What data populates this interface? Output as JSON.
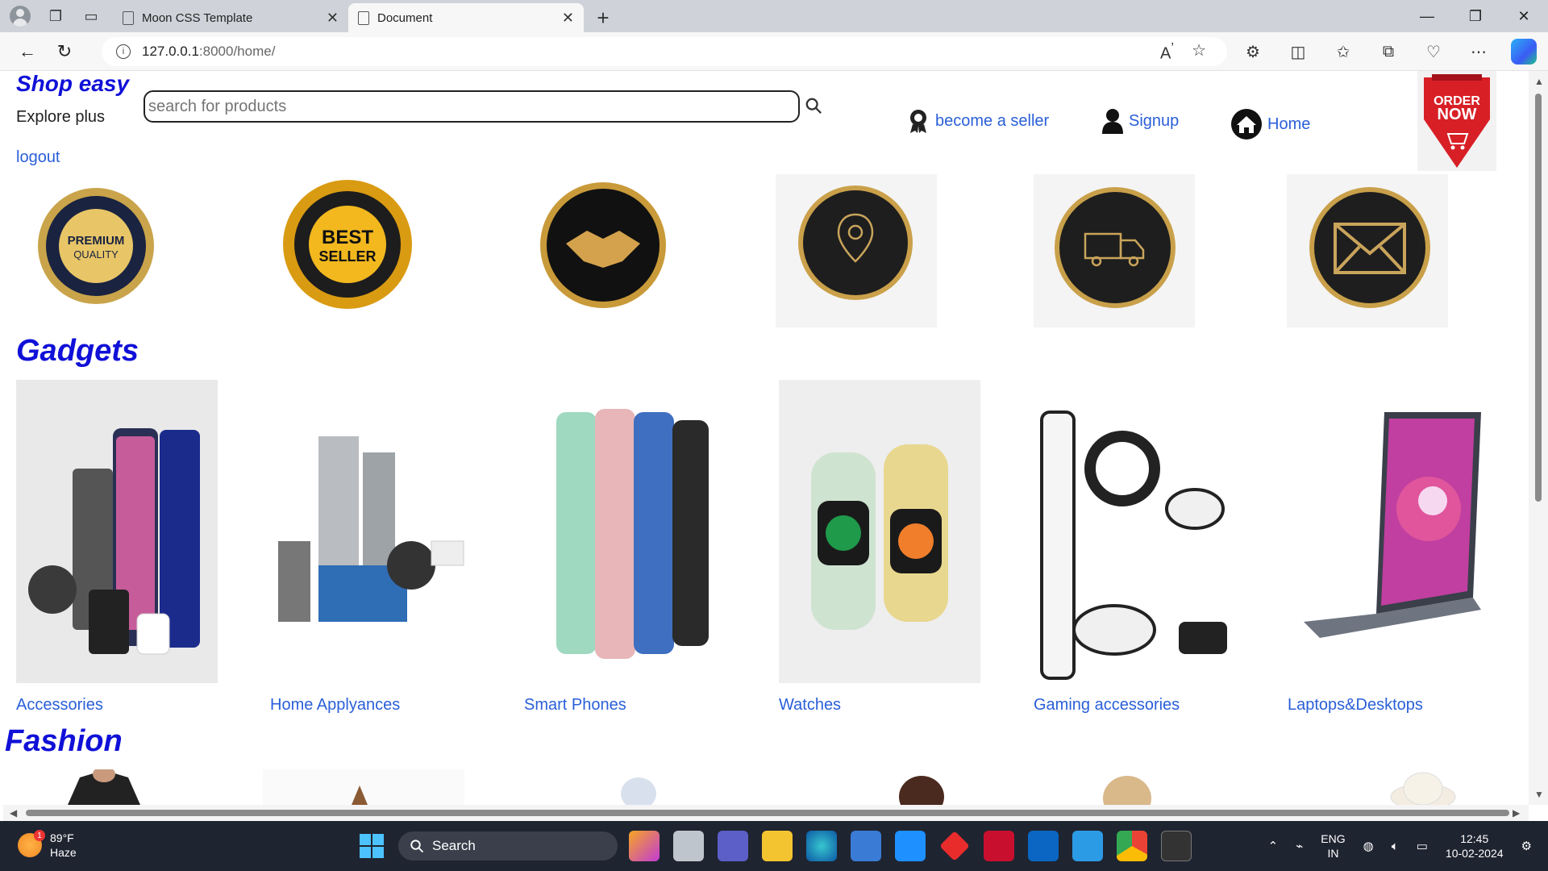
{
  "browser": {
    "tabs": [
      {
        "title": "Moon CSS Template"
      },
      {
        "title": "Document"
      }
    ],
    "url_host": "127.0.0.1",
    "url_path": ":8000/home/"
  },
  "site": {
    "brand": "Shop easy",
    "explore": "Explore plus",
    "logout": "logout",
    "search_placeholder": "search for products",
    "nav": {
      "seller": "become a seller",
      "signup": "Signup",
      "home": "Home"
    },
    "order_badge": {
      "line1": "ORDER",
      "line2": "NOW"
    },
    "badges": [
      {
        "name": "premium-quality",
        "text1": "PREMIUM",
        "text2": "QUALITY"
      },
      {
        "name": "best-seller",
        "text1": "BEST",
        "text2": "SELLER"
      },
      {
        "name": "handshake"
      },
      {
        "name": "location"
      },
      {
        "name": "delivery-truck"
      },
      {
        "name": "mail"
      }
    ],
    "sections": {
      "gadgets": "Gadgets",
      "fashion": "Fashion"
    },
    "gadgets": [
      {
        "label": "Accessories"
      },
      {
        "label": "Home Applyances"
      },
      {
        "label": "Smart Phones"
      },
      {
        "label": "Watches"
      },
      {
        "label": "Gaming accessories"
      },
      {
        "label": "Laptops&Desktops"
      }
    ]
  },
  "taskbar": {
    "weather_temp": "89°F",
    "weather_desc": "Haze",
    "weather_alerts": "1",
    "search_label": "Search",
    "lang1": "ENG",
    "lang2": "IN",
    "time": "12:45",
    "date": "10-02-2024"
  }
}
